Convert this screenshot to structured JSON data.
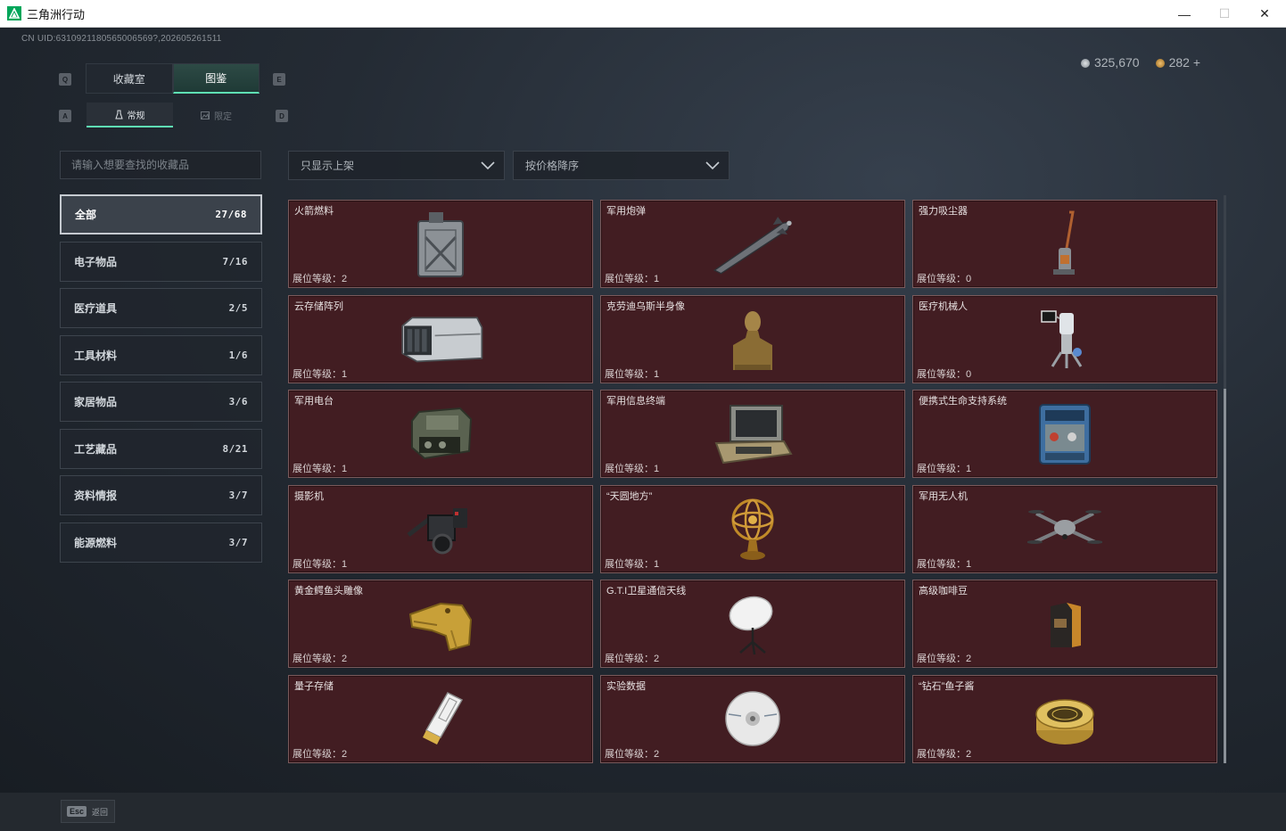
{
  "window": {
    "title": "三角洲行动",
    "minimize": "—",
    "maximize": "☐",
    "close": "✕"
  },
  "uid_text": "CN UID:6310921180565006569?,202605261511",
  "currency": {
    "coins": "325,670",
    "tokens": "282",
    "plus": "+"
  },
  "hotkeys": {
    "tab_prev": "Q",
    "tab_next": "E",
    "sub_prev": "A",
    "sub_next": "D"
  },
  "top_tabs": [
    {
      "label": "收藏室",
      "active": false
    },
    {
      "label": "图鉴",
      "active": true
    }
  ],
  "sub_tabs": [
    {
      "label": "常规",
      "active": true
    },
    {
      "label": "限定",
      "active": false
    }
  ],
  "search": {
    "placeholder": "请输入想要查找的收藏品"
  },
  "filters": {
    "show": "只显示上架",
    "sort": "按价格降序"
  },
  "categories": [
    {
      "label": "全部",
      "count": "27/68",
      "active": true
    },
    {
      "label": "电子物品",
      "count": "7/16"
    },
    {
      "label": "医疗道具",
      "count": "2/5"
    },
    {
      "label": "工具材料",
      "count": "1/6"
    },
    {
      "label": "家居物品",
      "count": "3/6"
    },
    {
      "label": "工艺藏品",
      "count": "8/21"
    },
    {
      "label": "资料情报",
      "count": "3/7"
    },
    {
      "label": "能源燃料",
      "count": "3/7"
    }
  ],
  "level_prefix": "展位等级：",
  "items": [
    {
      "name": "火箭燃料",
      "level": "2",
      "icon": "jerrycan-icon"
    },
    {
      "name": "军用炮弹",
      "level": "1",
      "icon": "missile-icon"
    },
    {
      "name": "强力吸尘器",
      "level": "0",
      "icon": "vacuum-icon"
    },
    {
      "name": "云存储阵列",
      "level": "1",
      "icon": "server-icon"
    },
    {
      "name": "克劳迪乌斯半身像",
      "level": "1",
      "icon": "bust-icon"
    },
    {
      "name": "医疗机械人",
      "level": "0",
      "icon": "robot-icon"
    },
    {
      "name": "军用电台",
      "level": "1",
      "icon": "radio-icon"
    },
    {
      "name": "军用信息终端",
      "level": "1",
      "icon": "terminal-icon"
    },
    {
      "name": "便携式生命支持系统",
      "level": "1",
      "icon": "life-support-icon"
    },
    {
      "name": "摄影机",
      "level": "1",
      "icon": "camera-icon"
    },
    {
      "name": "“天圆地方”",
      "level": "1",
      "icon": "armillary-icon"
    },
    {
      "name": "军用无人机",
      "level": "1",
      "icon": "drone-icon"
    },
    {
      "name": "黄金鳄鱼头雕像",
      "level": "2",
      "icon": "croc-head-icon"
    },
    {
      "name": "G.T.I卫星通信天线",
      "level": "2",
      "icon": "satellite-dish-icon"
    },
    {
      "name": "高级咖啡豆",
      "level": "2",
      "icon": "coffee-bag-icon"
    },
    {
      "name": "量子存储",
      "level": "2",
      "icon": "usb-drive-icon"
    },
    {
      "name": "实验数据",
      "level": "2",
      "icon": "disc-icon"
    },
    {
      "name": "“钻石”鱼子酱",
      "level": "2",
      "icon": "caviar-tin-icon"
    }
  ],
  "footer": {
    "esc_key": "Esc",
    "back_label": "返回"
  },
  "colors": {
    "accent": "#5fe0b4",
    "card_bg": "#421d22",
    "card_border": "#7a5a5c"
  }
}
